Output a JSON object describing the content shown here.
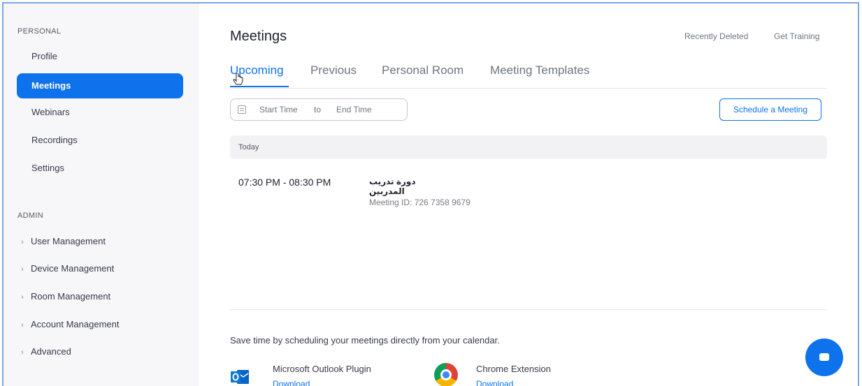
{
  "sidebar": {
    "personal_heading": "PERSONAL",
    "personal_items": [
      {
        "label": "Profile"
      },
      {
        "label": "Meetings",
        "active": true
      },
      {
        "label": "Webinars"
      },
      {
        "label": "Recordings"
      },
      {
        "label": "Settings"
      }
    ],
    "admin_heading": "ADMIN",
    "admin_items": [
      {
        "label": "User Management"
      },
      {
        "label": "Device Management"
      },
      {
        "label": "Room Management"
      },
      {
        "label": "Account Management"
      },
      {
        "label": "Advanced"
      }
    ]
  },
  "header": {
    "title": "Meetings",
    "recently_deleted": "Recently Deleted",
    "get_training": "Get Training"
  },
  "tabs": [
    {
      "label": "Upcoming",
      "active": true
    },
    {
      "label": "Previous"
    },
    {
      "label": "Personal Room"
    },
    {
      "label": "Meeting Templates"
    }
  ],
  "filter": {
    "start_placeholder": "Start Time",
    "separator": "to",
    "end_placeholder": "End Time",
    "schedule_button": "Schedule a Meeting"
  },
  "meetings": {
    "day_label": "Today",
    "items": [
      {
        "time": "07:30 PM - 08:30 PM",
        "topic": "دورة تدريب المدربين",
        "meeting_id": "Meeting ID: 726 7358 9679"
      }
    ]
  },
  "calendar_promo": {
    "text": "Save time by scheduling your meetings directly from your calendar.",
    "plugins": [
      {
        "name": "Microsoft Outlook Plugin",
        "action": "Download",
        "icon": "outlook-icon"
      },
      {
        "name": "Chrome Extension",
        "action": "Download",
        "icon": "chrome-icon"
      }
    ]
  },
  "colors": {
    "accent": "#0e72ed",
    "sidebar_bg": "#f7f7f9"
  }
}
